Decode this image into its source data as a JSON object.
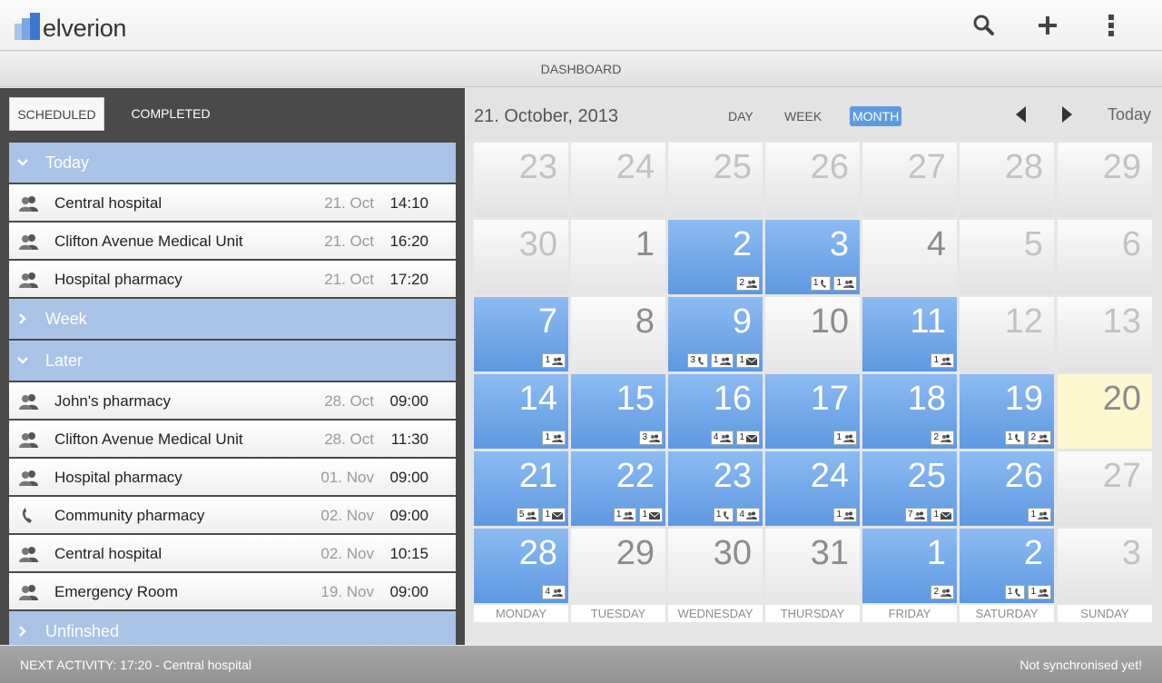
{
  "app": {
    "brand": "elverion",
    "actions": [
      {
        "name": "search-button",
        "icon": "search-icon"
      },
      {
        "name": "add-button",
        "icon": "plus-icon"
      },
      {
        "name": "menu-button",
        "icon": "kebab-menu-icon"
      }
    ]
  },
  "page_title": "DASHBOARD",
  "tabs": {
    "scheduled": "SCHEDULED",
    "completed": "COMPLETED"
  },
  "schedule": {
    "sections": [
      {
        "label": "Today",
        "expanded": true,
        "items": [
          {
            "type": "meeting",
            "name": "Central hospital",
            "date": "21. Oct",
            "time": "14:10"
          },
          {
            "type": "meeting",
            "name": "Clifton Avenue Medical Unit",
            "date": "21. Oct",
            "time": "16:20"
          },
          {
            "type": "meeting",
            "name": "Hospital pharmacy",
            "date": "21. Oct",
            "time": "17:20"
          }
        ]
      },
      {
        "label": "Week",
        "expanded": false,
        "items": []
      },
      {
        "label": "Later",
        "expanded": true,
        "items": [
          {
            "type": "meeting",
            "name": "John's pharmacy",
            "date": "28. Oct",
            "time": "09:00"
          },
          {
            "type": "meeting",
            "name": "Clifton Avenue Medical Unit",
            "date": "28. Oct",
            "time": "11:30"
          },
          {
            "type": "meeting",
            "name": "Hospital pharmacy",
            "date": "01. Nov",
            "time": "09:00"
          },
          {
            "type": "call",
            "name": "Community pharmacy",
            "date": "02. Nov",
            "time": "09:00"
          },
          {
            "type": "meeting",
            "name": "Central hospital",
            "date": "02. Nov",
            "time": "10:15"
          },
          {
            "type": "meeting",
            "name": "Emergency Room",
            "date": "19. Nov",
            "time": "09:00"
          }
        ]
      },
      {
        "label": "Unfinshed",
        "expanded": false,
        "items": []
      }
    ]
  },
  "calendar": {
    "current_date": "21. October, 2013",
    "views": {
      "day": "DAY",
      "week": "WEEK",
      "month": "MONTH"
    },
    "active_view": "month",
    "today_label": "Today",
    "weekdays": [
      "MONDAY",
      "TUESDAY",
      "WEDNESDAY",
      "THURSDAY",
      "FRIDAY",
      "SATURDAY",
      "SUNDAY"
    ],
    "weeks": [
      [
        {
          "day": "23",
          "style": "muted"
        },
        {
          "day": "24",
          "style": "muted"
        },
        {
          "day": "25",
          "style": "muted"
        },
        {
          "day": "26",
          "style": "muted"
        },
        {
          "day": "27",
          "style": "muted"
        },
        {
          "day": "28",
          "style": "muted"
        },
        {
          "day": "29",
          "style": "muted"
        }
      ],
      [
        {
          "day": "30",
          "style": "muted"
        },
        {
          "day": "1",
          "style": "plain"
        },
        {
          "day": "2",
          "style": "event",
          "badges": [
            {
              "count": "2",
              "kind": "meeting"
            }
          ]
        },
        {
          "day": "3",
          "style": "event",
          "badges": [
            {
              "count": "1",
              "kind": "call"
            },
            {
              "count": "1",
              "kind": "meeting"
            }
          ]
        },
        {
          "day": "4",
          "style": "plain"
        },
        {
          "day": "5",
          "style": "muted"
        },
        {
          "day": "6",
          "style": "muted"
        }
      ],
      [
        {
          "day": "7",
          "style": "event",
          "badges": [
            {
              "count": "1",
              "kind": "meeting"
            }
          ]
        },
        {
          "day": "8",
          "style": "plain"
        },
        {
          "day": "9",
          "style": "event",
          "badges": [
            {
              "count": "3",
              "kind": "call"
            },
            {
              "count": "1",
              "kind": "meeting"
            },
            {
              "count": "1",
              "kind": "mail"
            }
          ]
        },
        {
          "day": "10",
          "style": "plain"
        },
        {
          "day": "11",
          "style": "event",
          "badges": [
            {
              "count": "1",
              "kind": "meeting"
            }
          ]
        },
        {
          "day": "12",
          "style": "muted"
        },
        {
          "day": "13",
          "style": "muted"
        }
      ],
      [
        {
          "day": "14",
          "style": "event",
          "badges": [
            {
              "count": "1",
              "kind": "meeting"
            }
          ]
        },
        {
          "day": "15",
          "style": "event",
          "badges": [
            {
              "count": "3",
              "kind": "meeting"
            }
          ]
        },
        {
          "day": "16",
          "style": "event",
          "badges": [
            {
              "count": "4",
              "kind": "meeting"
            },
            {
              "count": "1",
              "kind": "mail"
            }
          ]
        },
        {
          "day": "17",
          "style": "event",
          "badges": [
            {
              "count": "1",
              "kind": "meeting"
            }
          ]
        },
        {
          "day": "18",
          "style": "event",
          "badges": [
            {
              "count": "2",
              "kind": "meeting"
            }
          ]
        },
        {
          "day": "19",
          "style": "event",
          "badges": [
            {
              "count": "1",
              "kind": "call"
            },
            {
              "count": "2",
              "kind": "meeting"
            }
          ]
        },
        {
          "day": "20",
          "style": "today"
        }
      ],
      [
        {
          "day": "21",
          "style": "event",
          "badges": [
            {
              "count": "5",
              "kind": "meeting"
            },
            {
              "count": "1",
              "kind": "mail"
            }
          ]
        },
        {
          "day": "22",
          "style": "event",
          "badges": [
            {
              "count": "1",
              "kind": "meeting"
            },
            {
              "count": "1",
              "kind": "mail"
            }
          ]
        },
        {
          "day": "23",
          "style": "event",
          "badges": [
            {
              "count": "1",
              "kind": "call"
            },
            {
              "count": "4",
              "kind": "meeting"
            }
          ]
        },
        {
          "day": "24",
          "style": "event",
          "badges": [
            {
              "count": "1",
              "kind": "meeting"
            }
          ]
        },
        {
          "day": "25",
          "style": "event",
          "badges": [
            {
              "count": "7",
              "kind": "meeting"
            },
            {
              "count": "1",
              "kind": "mail"
            }
          ]
        },
        {
          "day": "26",
          "style": "event",
          "badges": [
            {
              "count": "1",
              "kind": "meeting"
            }
          ]
        },
        {
          "day": "27",
          "style": "muted"
        }
      ],
      [
        {
          "day": "28",
          "style": "event",
          "badges": [
            {
              "count": "4",
              "kind": "meeting"
            }
          ]
        },
        {
          "day": "29",
          "style": "plain"
        },
        {
          "day": "30",
          "style": "plain"
        },
        {
          "day": "31",
          "style": "plain"
        },
        {
          "day": "1",
          "style": "event",
          "badges": [
            {
              "count": "2",
              "kind": "meeting"
            }
          ]
        },
        {
          "day": "2",
          "style": "event",
          "badges": [
            {
              "count": "1",
              "kind": "call"
            },
            {
              "count": "1",
              "kind": "meeting"
            }
          ]
        },
        {
          "day": "3",
          "style": "muted"
        }
      ]
    ]
  },
  "footer": {
    "next_activity": "NEXT ACTIVITY: 17:20 - Central hospital",
    "sync_status": "Not synchronised yet!"
  },
  "colors": {
    "accent_blue": "#5e98e2",
    "section_blue": "#a8c3e6",
    "today_yellow": "#fdf8cf",
    "panel_dark": "#4a4a4a"
  }
}
